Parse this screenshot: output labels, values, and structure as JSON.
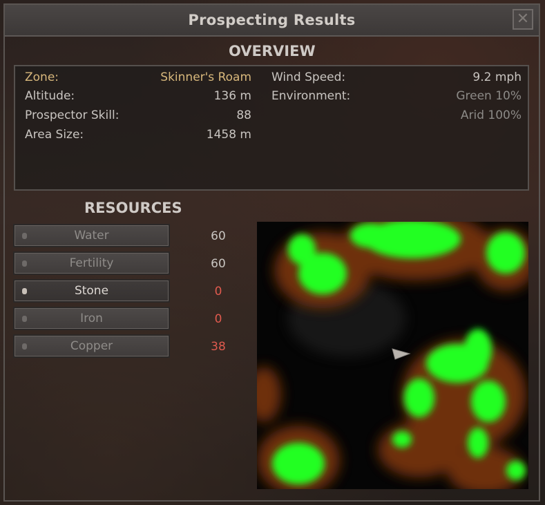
{
  "window": {
    "title": "Prospecting Results",
    "close_glyph": "✕",
    "close_icon": "close-icon"
  },
  "overview": {
    "heading": "OVERVIEW",
    "zone_label": "Zone:",
    "zone_value": "Skinner's Roam",
    "altitude_label": "Altitude:",
    "altitude_value": "136 m",
    "skill_label": "Prospector Skill:",
    "skill_value": "88",
    "area_label": "Area Size:",
    "area_value": "1458 m",
    "wind_label": "Wind Speed:",
    "wind_value": "9.2 mph",
    "env_label": "Environment:",
    "env_values": [
      "Green 10%",
      "Arid 100%"
    ]
  },
  "resources": {
    "heading": "RESOURCES",
    "items": [
      {
        "label": "Water",
        "value": "60",
        "selected": false,
        "value_color": "normal"
      },
      {
        "label": "Fertility",
        "value": "60",
        "selected": false,
        "value_color": "normal"
      },
      {
        "label": "Stone",
        "value": "0",
        "selected": true,
        "value_color": "red"
      },
      {
        "label": "Iron",
        "value": "0",
        "selected": false,
        "value_color": "red"
      },
      {
        "label": "Copper",
        "value": "38",
        "selected": false,
        "value_color": "red"
      }
    ]
  },
  "map": {
    "player_marker": "arrow-marker-icon",
    "deposit_color": "#22ff22",
    "edge_color": "#8a3a10"
  },
  "colors": {
    "gold": "#d8b87c",
    "red": "#e05a4e"
  }
}
